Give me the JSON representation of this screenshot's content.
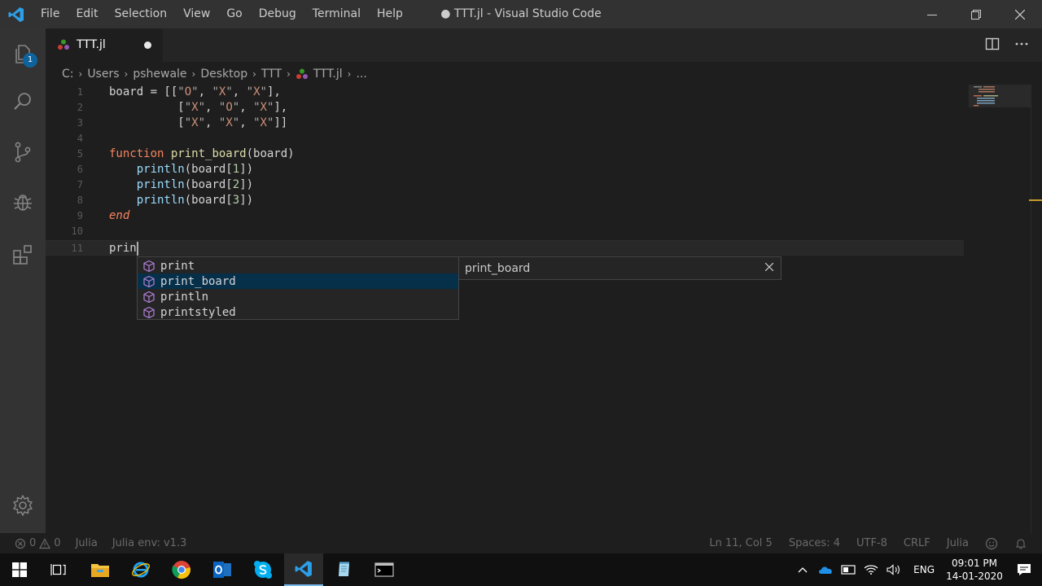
{
  "window": {
    "title": "● TTT.jl - Visual Studio Code",
    "menu": [
      "File",
      "Edit",
      "Selection",
      "View",
      "Go",
      "Debug",
      "Terminal",
      "Help"
    ]
  },
  "activity": {
    "explorer_badge": "1",
    "icons": [
      "files-icon",
      "search-icon",
      "source-control-icon",
      "debug-icon",
      "extensions-icon",
      "gear-icon"
    ]
  },
  "tab": {
    "name": "TTT.jl"
  },
  "breadcrumb": [
    "C:",
    "Users",
    "pshewale",
    "Desktop",
    "TTT",
    "TTT.jl",
    "..."
  ],
  "editor": {
    "line_numbers": [
      "1",
      "2",
      "3",
      "4",
      "5",
      "6",
      "7",
      "8",
      "9",
      "10",
      "11"
    ],
    "typed_text": "prin"
  },
  "suggest": {
    "items": [
      "print",
      "print_board",
      "println",
      "printstyled"
    ],
    "selected_index": 1,
    "detail": "print_board"
  },
  "status": {
    "errors": "0",
    "warnings": "0",
    "language_left": "Julia",
    "env": "Julia env: v1.3",
    "position": "Ln 11, Col 5",
    "spaces": "Spaces: 4",
    "encoding": "UTF-8",
    "eol": "CRLF",
    "language": "Julia"
  },
  "taskbar": {
    "lang": "ENG",
    "time": "09:01 PM",
    "date": "14-01-2020"
  },
  "colors": {
    "accent": "#0e639c",
    "titlebar": "#323233",
    "editor_bg": "#1e1e1e"
  }
}
